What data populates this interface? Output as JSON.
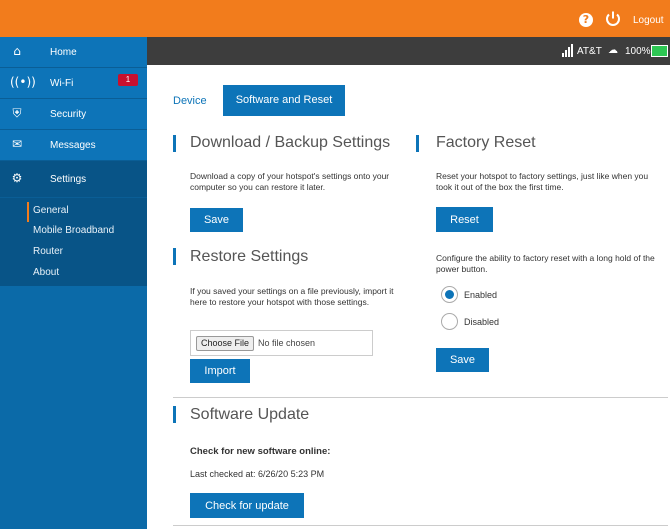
{
  "topbar": {
    "help_icon": "help-icon",
    "power_icon": "power-icon",
    "logout": "Logout",
    "color": "#f27c1c"
  },
  "status": {
    "carrier": "AT&T",
    "battery": "100%"
  },
  "sidebar": {
    "items": [
      {
        "label": "Home",
        "icon": "home-icon"
      },
      {
        "label": "Wi-Fi",
        "icon": "wifi-icon",
        "badge": "1"
      },
      {
        "label": "Security",
        "icon": "shield-icon"
      },
      {
        "label": "Messages",
        "icon": "envelope-icon"
      },
      {
        "label": "Settings",
        "icon": "gear-icon"
      }
    ],
    "sub_items": [
      "General",
      "Mobile Broadband",
      "Router",
      "About"
    ]
  },
  "tabs": {
    "device": "Device",
    "software": "Software and Reset"
  },
  "backup": {
    "title": "Download / Backup Settings",
    "text": "Download a copy of your hotspot's settings onto your computer so you can restore it later.",
    "save": "Save"
  },
  "restore": {
    "title": "Restore Settings",
    "text": "If you saved your settings on a file previously, import it here to restore your hotspot with those settings.",
    "choose_file": "Choose File",
    "no_file": "No file chosen",
    "import": "Import"
  },
  "reset": {
    "title": "Factory Reset",
    "text": "Reset your hotspot to factory settings, just like when you took it out of the box the first time.",
    "reset_button": "Reset",
    "configure_text": "Configure the ability to factory reset with a long hold of the power button.",
    "enabled": "Enabled",
    "disabled": "Disabled",
    "selected": "Enabled",
    "save": "Save"
  },
  "update": {
    "title": "Software Update",
    "check_heading": "Check for new software online:",
    "last_checked": "Last checked at: 6/26/20 5:23 PM",
    "check_button": "Check for update"
  }
}
